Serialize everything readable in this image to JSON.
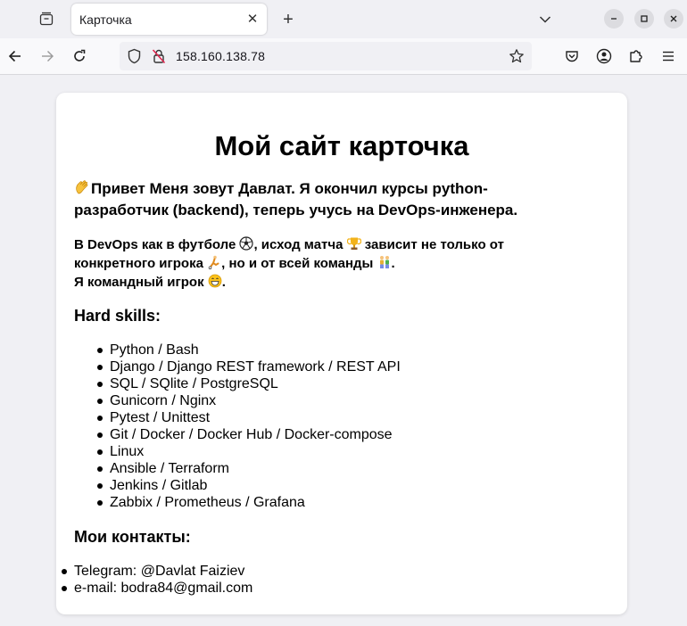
{
  "browser": {
    "tab_title": "Карточка",
    "tab_close": "✕",
    "new_tab": "+",
    "url": "158.160.138.78"
  },
  "page": {
    "title": "Мой сайт карточка",
    "intro": "Привет Меня зовут Давлат. Я окончил курсы python-разработчик (backend), теперь учусь на DevOps-инженера.",
    "devops_part1": "В DevOps как в футболе",
    "devops_part2": ", исход матча",
    "devops_part3": " зависит не только от конкретного игрока",
    "devops_part4": ", но и от всей команды",
    "devops_part5": ".",
    "team_player": "Я командный игрок",
    "team_player_end": ".",
    "hard_skills_heading": "Hard skills:",
    "skills": [
      "Python / Bash",
      "Django / Django REST framework / REST API",
      "SQL / SQlite / PostgreSQL",
      "Gunicorn / Nginx",
      "Pytest / Unittest",
      "Git / Docker / Docker Hub / Docker-compose",
      "Linux",
      "Ansible / Terraform",
      "Jenkins / Gitlab",
      "Zabbix / Prometheus / Grafana"
    ],
    "contacts_heading": "Мои контакты:",
    "contacts": [
      "Telegram: @Davlat Faiziev",
      "e-mail: bodra84@gmail.com"
    ]
  }
}
